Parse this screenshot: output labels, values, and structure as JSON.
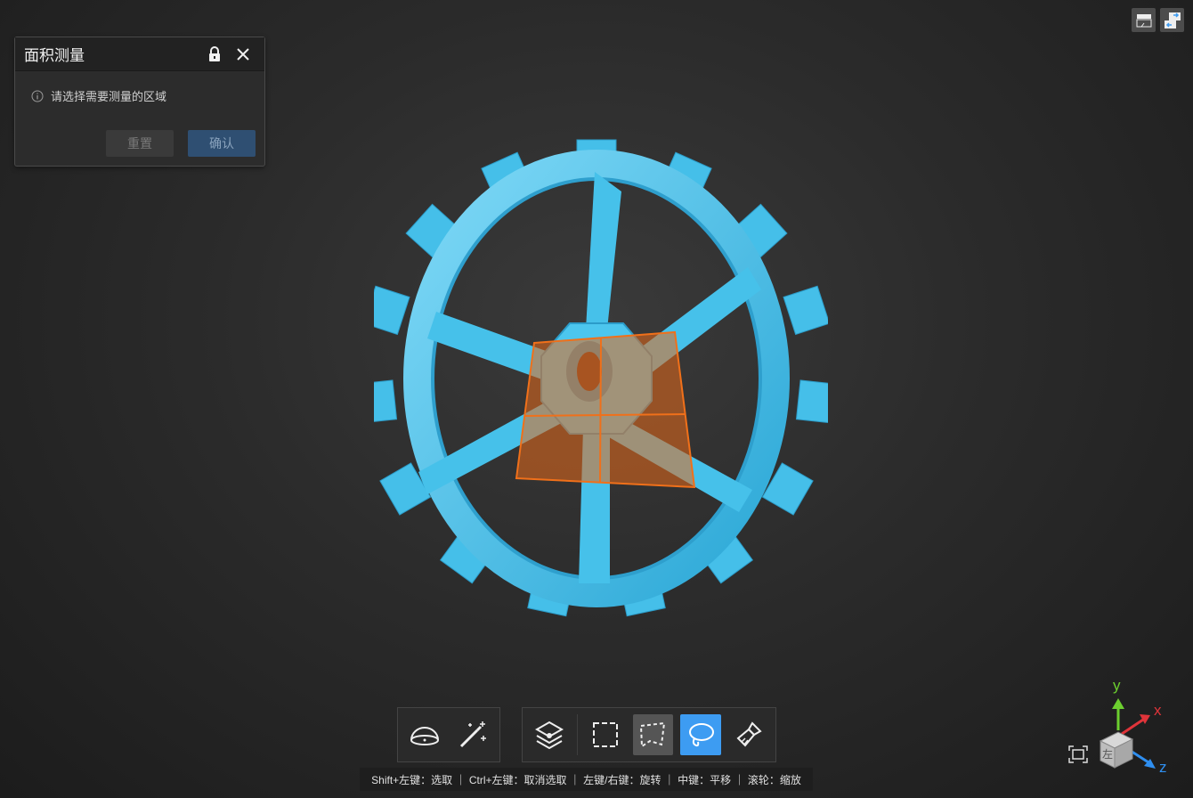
{
  "panel": {
    "title": "面积测量",
    "hint": "请选择需要测量的区域",
    "reset_label": "重置",
    "confirm_label": "确认"
  },
  "toolbar": {
    "tools_left": [
      "hemisphere-icon",
      "magic-wand-icon"
    ],
    "tools_right": [
      "layers-icon",
      "rect-select-icon",
      "polygon-select-icon",
      "lasso-select-icon",
      "brush-icon"
    ],
    "active_tool": "lasso-select-icon"
  },
  "status": {
    "text": "Shift+左键：选取 ｜ Ctrl+左键：取消选取 ｜ 左键/右键：旋转 ｜ 中键：平移 ｜ 滚轮：缩放"
  },
  "gizmo": {
    "x_label": "x",
    "y_label": "y",
    "z_label": "z",
    "cube_face_label": "左"
  },
  "colors": {
    "model": "#4cc6ee",
    "selection": "#e86a1a",
    "accent": "#3d9cf2",
    "x_axis": "#e0343a",
    "y_axis": "#6ccf2f",
    "z_axis": "#2f8ff0"
  }
}
